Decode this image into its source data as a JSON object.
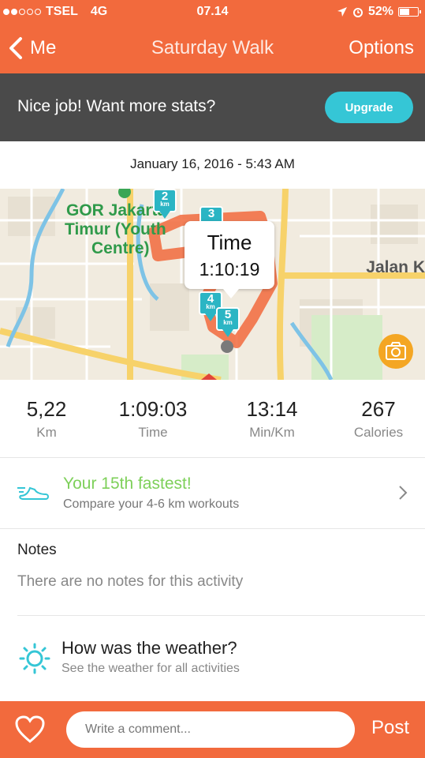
{
  "status_bar": {
    "carrier": "TSEL",
    "network": "4G",
    "time": "07.14",
    "battery": "52%"
  },
  "nav": {
    "back_label": "Me",
    "title": "Saturday Walk",
    "options_label": "Options"
  },
  "banner": {
    "message": "Nice job! Want more stats?",
    "upgrade_label": "Upgrade"
  },
  "activity": {
    "date": "January 16, 2016 - 5:43 AM"
  },
  "map": {
    "place_label_line1": "GOR Jakarta",
    "place_label_line2": "Timur (Youth",
    "place_label_line3": "Centre)",
    "road_label": "Jalan K",
    "markers": [
      {
        "number": "2",
        "unit": "km"
      },
      {
        "number": "3",
        "unit": ""
      },
      {
        "number": "4",
        "unit": "km"
      },
      {
        "number": "5",
        "unit": "km"
      }
    ],
    "tooltip": {
      "label": "Time",
      "value": "1:10:19"
    },
    "route_color": "#f26a3d",
    "marker_color": "#2bb5c4"
  },
  "stats": [
    {
      "value": "5,22",
      "label": "Km"
    },
    {
      "value": "1:09:03",
      "label": "Time"
    },
    {
      "value": "13:14",
      "label": "Min/Km"
    },
    {
      "value": "267",
      "label": "Calories"
    }
  ],
  "fastest": {
    "title": "Your 15th fastest!",
    "subtitle": "Compare your 4-6 km workouts",
    "icon": "shoe-icon"
  },
  "notes": {
    "heading": "Notes",
    "body": "There are no notes for this activity"
  },
  "weather": {
    "title": "How was the weather?",
    "subtitle": "See the weather for all activities",
    "icon": "sun-icon"
  },
  "comment_bar": {
    "placeholder": "Write a comment...",
    "post_label": "Post"
  },
  "colors": {
    "brand": "#f26a3d",
    "banner": "#4a4a4a",
    "accent": "#35c6d6",
    "highlight": "#7ed05a"
  }
}
